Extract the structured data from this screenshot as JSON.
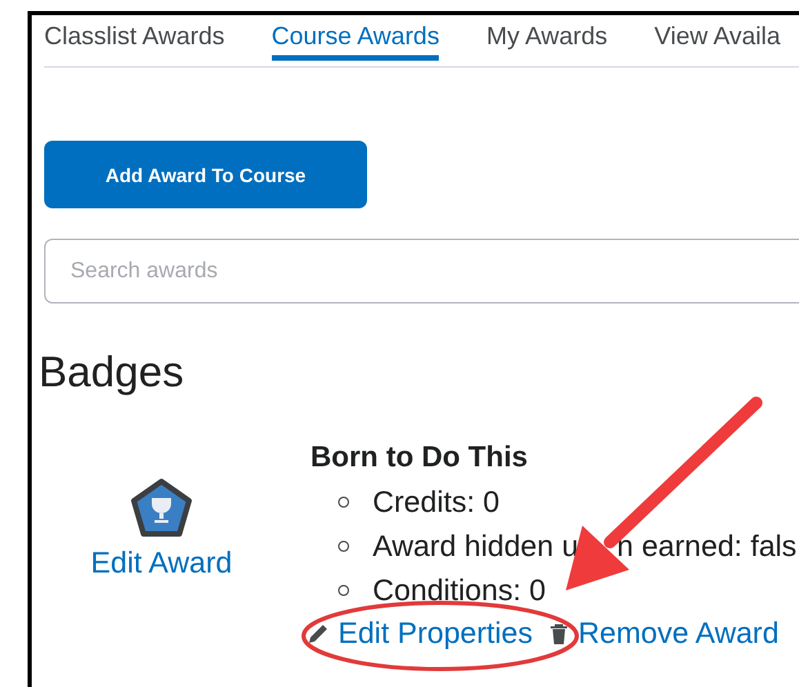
{
  "tabs": [
    {
      "label": "Classlist Awards",
      "selected": false
    },
    {
      "label": "Course Awards",
      "selected": true
    },
    {
      "label": "My Awards",
      "selected": false
    },
    {
      "label": "View Availa",
      "selected": false
    }
  ],
  "add_button": "Add Award To Course",
  "search": {
    "placeholder": "Search awards"
  },
  "section_title": "Badges",
  "award": {
    "edit_link": "Edit Award",
    "title": "Born to Do This",
    "details": [
      {
        "parts": [
          "Credits: 0"
        ]
      },
      {
        "parts": [
          "Award hidden u",
          "n earned: fals"
        ]
      },
      {
        "parts": [
          "Conditions: 0"
        ]
      }
    ],
    "actions": [
      {
        "kind": "edit",
        "label": "Edit Properties"
      },
      {
        "kind": "remove",
        "label": "Remove Award"
      }
    ]
  }
}
